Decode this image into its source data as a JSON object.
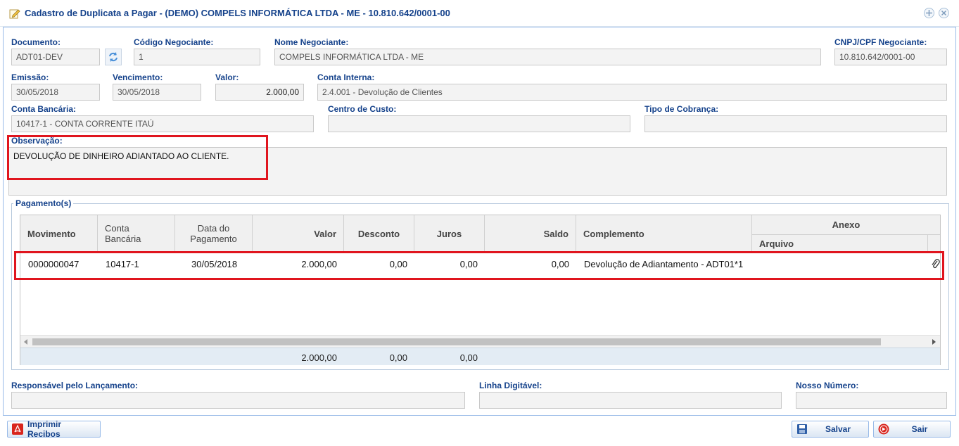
{
  "window": {
    "title": "Cadastro de Duplicata a Pagar - (DEMO) COMPELS INFORMÁTICA LTDA - ME - 10.810.642/0001-00"
  },
  "form": {
    "documento": {
      "label": "Documento:",
      "value": "ADT01-DEV"
    },
    "codigo_negociante": {
      "label": "Código Negociante:",
      "value": "1"
    },
    "nome_negociante": {
      "label": "Nome Negociante:",
      "value": "COMPELS INFORMÁTICA LTDA - ME"
    },
    "cnpj": {
      "label": "CNPJ/CPF Negociante:",
      "value": "10.810.642/0001-00"
    },
    "emissao": {
      "label": "Emissão:",
      "value": "30/05/2018"
    },
    "vencimento": {
      "label": "Vencimento:",
      "value": "30/05/2018"
    },
    "valor": {
      "label": "Valor:",
      "value": "2.000,00"
    },
    "conta_interna": {
      "label": "Conta Interna:",
      "value": "2.4.001 - Devolução de Clientes"
    },
    "conta_bancaria": {
      "label": "Conta Bancária:",
      "value": "10417-1 - CONTA CORRENTE ITAÚ"
    },
    "centro_custo": {
      "label": "Centro de Custo:",
      "value": ""
    },
    "tipo_cobranca": {
      "label": "Tipo de Cobrança:",
      "value": ""
    },
    "observacao": {
      "label": "Observação:",
      "value": "DEVOLUÇÃO DE DINHEIRO ADIANTADO AO CLIENTE."
    },
    "responsavel": {
      "label": "Responsável pelo Lançamento:",
      "value": ""
    },
    "linha_digitavel": {
      "label": "Linha Digitável:",
      "value": ""
    },
    "nosso_numero": {
      "label": "Nosso Número:",
      "value": ""
    }
  },
  "pagamentos": {
    "legend": "Pagamento(s)",
    "columns": {
      "movimento": "Movimento",
      "conta_bancaria": "Conta Bancária",
      "data_pagamento": "Data do Pagamento",
      "valor": "Valor",
      "desconto": "Desconto",
      "juros": "Juros",
      "saldo": "Saldo",
      "complemento": "Complemento",
      "anexo": "Anexo",
      "arquivo": "Arquivo"
    },
    "rows": [
      {
        "movimento": "0000000047",
        "conta_bancaria": "10417-1",
        "data_pagamento": "30/05/2018",
        "valor": "2.000,00",
        "desconto": "0,00",
        "juros": "0,00",
        "saldo": "0,00",
        "complemento": "Devolução de Adiantamento - ADT01*1",
        "anexo_icon": "paperclip-icon"
      }
    ],
    "totals": {
      "valor": "2.000,00",
      "desconto": "0,00",
      "juros": "0,00"
    }
  },
  "buttons": {
    "imprimir": "Imprimir Recibos",
    "salvar": "Salvar",
    "sair": "Sair"
  },
  "colors": {
    "label": "#15428b",
    "highlight": "#e0151e",
    "border": "#99bbe8"
  }
}
